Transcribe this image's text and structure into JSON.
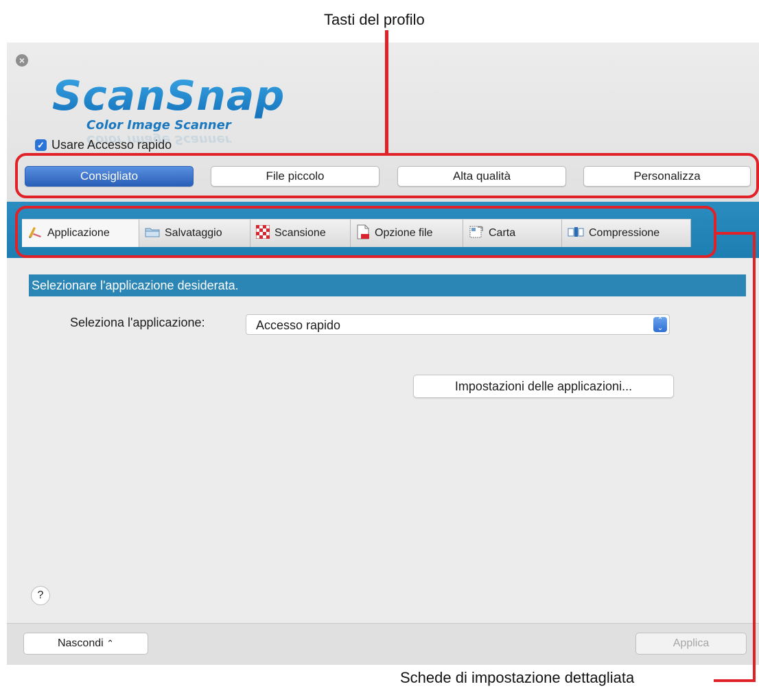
{
  "callouts": {
    "profile_buttons": "Tasti del profilo",
    "detail_tabs": "Schede di impostazione dettagliata"
  },
  "window": {
    "close_icon": "close-icon",
    "logo_text": "ScanSnap",
    "logo_subtext": "Color Image Scanner",
    "quick_menu_checkbox": {
      "label": "Usare Accesso rapido",
      "checked": true
    },
    "profiles": [
      {
        "label": "Consigliato",
        "active": true
      },
      {
        "label": "File piccolo",
        "active": false
      },
      {
        "label": "Alta qualità",
        "active": false
      },
      {
        "label": "Personalizza",
        "active": false
      }
    ],
    "tabs": [
      {
        "label": "Applicazione",
        "icon": "pencil-icon",
        "active": true
      },
      {
        "label": "Salvataggio",
        "icon": "folder-icon",
        "active": false
      },
      {
        "label": "Scansione",
        "icon": "checkerboard-icon",
        "active": false
      },
      {
        "label": "Opzione file",
        "icon": "document-icon",
        "active": false
      },
      {
        "label": "Carta",
        "icon": "paper-icon",
        "active": false
      },
      {
        "label": "Compressione",
        "icon": "compression-icon",
        "active": false
      }
    ],
    "panel": {
      "section_title": "Selezionare l'applicazione desiderata.",
      "select_label": "Seleziona l'applicazione:",
      "select_value": "Accesso rapido",
      "settings_button": "Impostazioni delle applicazioni...",
      "help_label": "?"
    },
    "footer": {
      "hide_button": "Nascondi",
      "apply_button": "Applica"
    }
  },
  "colors": {
    "accent_blue": "#2b86b6",
    "profile_active": "#2a5fb8",
    "annotation_red": "#e02128"
  }
}
